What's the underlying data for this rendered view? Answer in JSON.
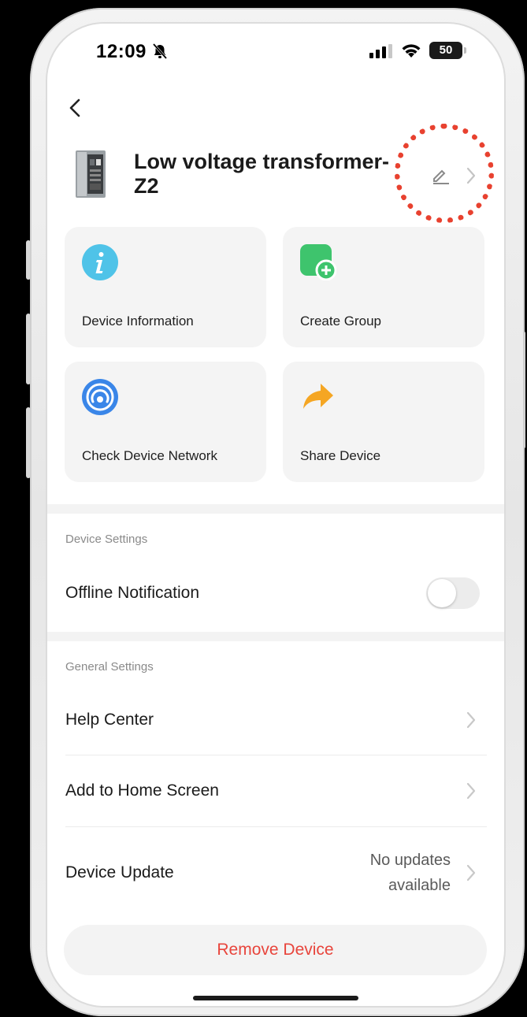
{
  "status_bar": {
    "time": "12:09",
    "battery": "50"
  },
  "header": {
    "device_name": "Low voltage transformer-Z2"
  },
  "cards": [
    {
      "label": "Device Information",
      "icon": "info-icon",
      "color": "#4fc3e8"
    },
    {
      "label": "Create Group",
      "icon": "create-group-icon",
      "color": "#3ec46d"
    },
    {
      "label": "Check Device Network",
      "icon": "network-icon",
      "color": "#3a86e8"
    },
    {
      "label": "Share Device",
      "icon": "share-arrow-icon",
      "color": "#f5a623"
    }
  ],
  "device_settings": {
    "title": "Device Settings",
    "offline_notification": {
      "label": "Offline Notification",
      "enabled": false
    }
  },
  "general_settings": {
    "title": "General Settings",
    "help_center": "Help Center",
    "add_to_home": "Add to Home Screen",
    "device_update": {
      "label": "Device Update",
      "status_line1": "No updates",
      "status_line2": "available"
    }
  },
  "remove_button": "Remove Device",
  "colors": {
    "accent_red": "#e8453c",
    "highlight": "#e8412f"
  }
}
